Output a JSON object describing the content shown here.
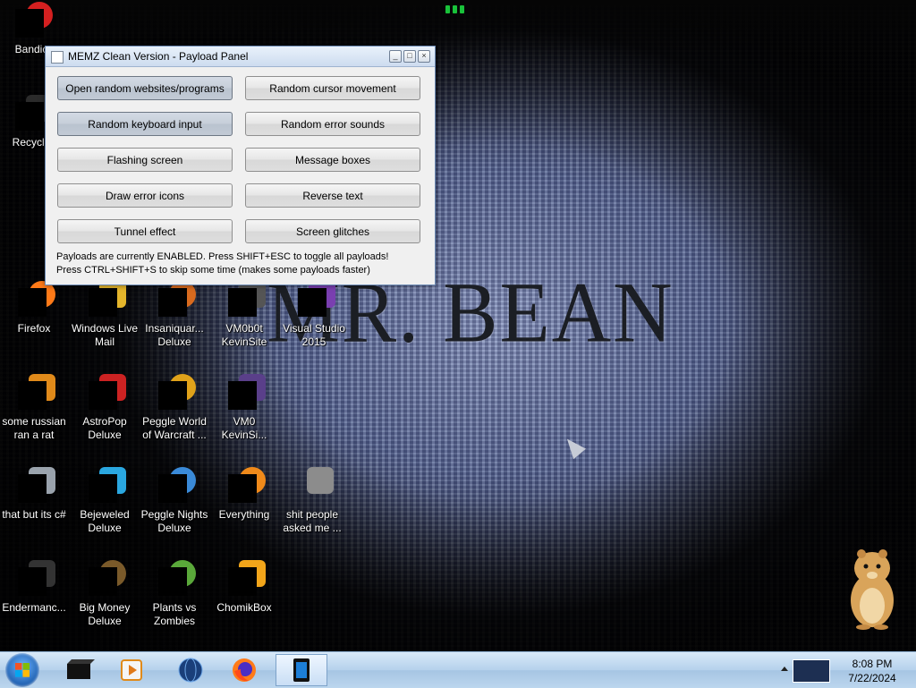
{
  "window": {
    "title": "MEMZ Clean Version - Payload Panel",
    "buttons": [
      {
        "label": "Open random websites/programs",
        "active": true
      },
      {
        "label": "Random cursor movement",
        "active": false
      },
      {
        "label": "Random keyboard input",
        "active": true
      },
      {
        "label": "Random error sounds",
        "active": false
      },
      {
        "label": "Flashing screen",
        "active": false
      },
      {
        "label": "Message boxes",
        "active": false
      },
      {
        "label": "Draw error icons",
        "active": false
      },
      {
        "label": "Reverse text",
        "active": false
      },
      {
        "label": "Tunnel effect",
        "active": false
      },
      {
        "label": "Screen glitches",
        "active": false
      }
    ],
    "status_line1": "Payloads are currently ENABLED. Press SHIFT+ESC to toggle all payloads!",
    "status_line2": "Press CTRL+SHIFT+S to skip some time (makes some payloads faster)"
  },
  "wallpaper_text": "MR. BEAN",
  "desktop_icons": [
    {
      "label": "Bandic",
      "icon": "bandicam-icon",
      "color": "#d42020"
    },
    {
      "label": "Recycle",
      "icon": "recycle-bin-icon",
      "color": "#2b2b2b"
    },
    {
      "label": "Firefox",
      "icon": "firefox-icon",
      "color": "#ff7a18"
    },
    {
      "label": "Windows Live Mail",
      "icon": "mail-icon",
      "color": "#e4b52b"
    },
    {
      "label": "Insaniquar... Deluxe",
      "icon": "insaniquarium-icon",
      "color": "#d86a1e"
    },
    {
      "label": "VM0b0t KevinSite",
      "icon": "vm-icon",
      "color": "#555555"
    },
    {
      "label": "Visual Studio 2015",
      "icon": "visual-studio-icon",
      "color": "#7a3fb0"
    },
    {
      "label": "some russian ran a rat",
      "icon": "file-icon",
      "color": "#e08a1a"
    },
    {
      "label": "AstroPop Deluxe",
      "icon": "astropop-icon",
      "color": "#cc2222"
    },
    {
      "label": "Peggle World of Warcraft ...",
      "icon": "peggle-wow-icon",
      "color": "#e0a21a"
    },
    {
      "label": "VM0 KevinSi...",
      "icon": "vm-icon",
      "color": "#5a3f8a"
    },
    {
      "label": "that but its c#",
      "icon": "copy-icon",
      "color": "#9aa3ad"
    },
    {
      "label": "Bejeweled Deluxe",
      "icon": "bejeweled-icon",
      "color": "#2aa7e0"
    },
    {
      "label": "Peggle Nights Deluxe",
      "icon": "peggle-nights-icon",
      "color": "#3a8ad8"
    },
    {
      "label": "Everything",
      "icon": "everything-icon",
      "color": "#f08a1a"
    },
    {
      "label": "shit people asked me ...",
      "icon": "folder-icon",
      "color": "#8c8c8c"
    },
    {
      "label": "Endermanc...",
      "icon": "terminal-icon",
      "color": "#333333"
    },
    {
      "label": "Big Money Deluxe",
      "icon": "money-bag-icon",
      "color": "#7a5a2a"
    },
    {
      "label": "Plants vs Zombies",
      "icon": "plants-icon",
      "color": "#5aa83a"
    },
    {
      "label": "ChomikBox",
      "icon": "chomikbox-icon",
      "color": "#f2a51a"
    }
  ],
  "taskbar": {
    "items": [
      {
        "name": "media-center",
        "icon": "media-center-icon"
      },
      {
        "name": "media-player",
        "icon": "media-player-icon"
      },
      {
        "name": "globe",
        "icon": "globe-icon"
      },
      {
        "name": "firefox",
        "icon": "firefox-icon"
      },
      {
        "name": "memz",
        "icon": "memz-icon",
        "active": true
      }
    ],
    "time": "8:08 PM",
    "date": "7/22/2024"
  }
}
